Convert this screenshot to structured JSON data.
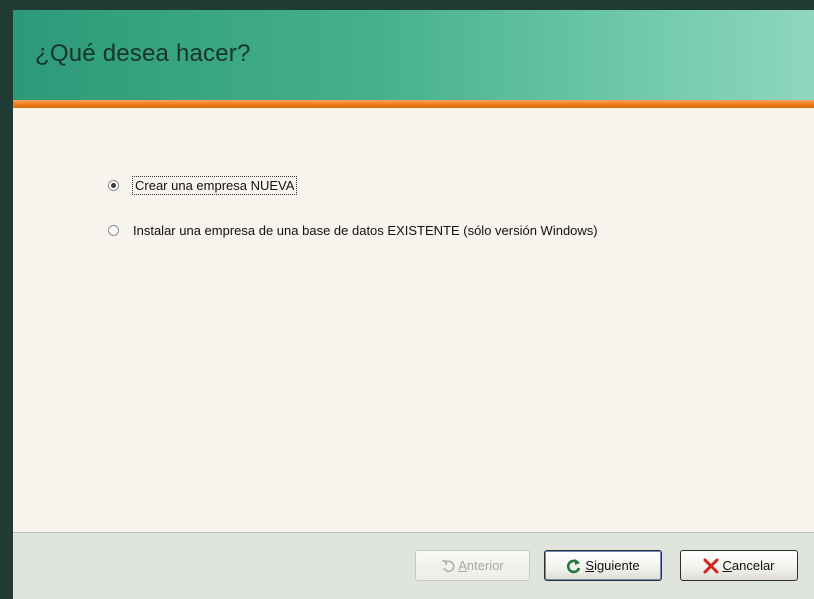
{
  "header": {
    "title": "¿Qué desea hacer?"
  },
  "options": [
    {
      "label": "Crear una empresa NUEVA",
      "selected": true
    },
    {
      "label": "Instalar una empresa de una base de datos EXISTENTE (sólo versión Windows)",
      "selected": false
    }
  ],
  "buttons": {
    "previous": {
      "label": "Anterior",
      "enabled": false,
      "icon": "undo-arrow-icon"
    },
    "next": {
      "label": "Siguiente",
      "enabled": true,
      "icon": "refresh-arrow-icon"
    },
    "cancel": {
      "label": "Cancelar",
      "enabled": true,
      "icon": "red-x-icon"
    }
  },
  "colors": {
    "header_gradient_start": "#2c9a78",
    "header_gradient_end": "#8fd7bd",
    "accent_orange": "#ef7e1e",
    "content_bg": "#f6f4ec",
    "footer_bg": "#dfe5dd",
    "cancel_icon": "#d42020"
  }
}
